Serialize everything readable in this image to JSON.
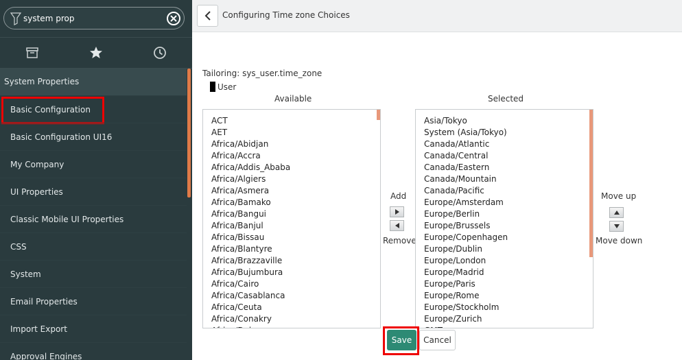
{
  "sidebar": {
    "filter_value": "system prop",
    "tabs": [
      {
        "icon": "archive-icon"
      },
      {
        "icon": "star-icon"
      },
      {
        "icon": "clock-icon"
      }
    ],
    "section": "System Properties",
    "items": [
      {
        "label": "Basic Configuration"
      },
      {
        "label": "Basic Configuration UI16"
      },
      {
        "label": "My Company"
      },
      {
        "label": "UI Properties"
      },
      {
        "label": "Classic Mobile UI Properties"
      },
      {
        "label": "CSS"
      },
      {
        "label": "System"
      },
      {
        "label": "Email Properties"
      },
      {
        "label": "Import Export"
      },
      {
        "label": "Approval Engines"
      }
    ]
  },
  "header": {
    "title": "Configuring Time zone Choices"
  },
  "tailoring": {
    "label": "Tailoring:",
    "value": "sys_user.time_zone",
    "user": "User"
  },
  "available": {
    "heading": "Available",
    "items": [
      "ACT",
      "AET",
      "Africa/Abidjan",
      "Africa/Accra",
      "Africa/Addis_Ababa",
      "Africa/Algiers",
      "Africa/Asmera",
      "Africa/Bamako",
      "Africa/Bangui",
      "Africa/Banjul",
      "Africa/Bissau",
      "Africa/Blantyre",
      "Africa/Brazzaville",
      "Africa/Bujumbura",
      "Africa/Cairo",
      "Africa/Casablanca",
      "Africa/Ceuta",
      "Africa/Conakry",
      "Africa/Dakar"
    ]
  },
  "selected": {
    "heading": "Selected",
    "items": [
      "Asia/Tokyo",
      "System (Asia/Tokyo)",
      "Canada/Atlantic",
      "Canada/Central",
      "Canada/Eastern",
      "Canada/Mountain",
      "Canada/Pacific",
      "Europe/Amsterdam",
      "Europe/Berlin",
      "Europe/Brussels",
      "Europe/Copenhagen",
      "Europe/Dublin",
      "Europe/London",
      "Europe/Madrid",
      "Europe/Paris",
      "Europe/Rome",
      "Europe/Stockholm",
      "Europe/Zurich",
      "GMT"
    ]
  },
  "controls": {
    "add": "Add",
    "remove": "Remove",
    "move_up": "Move up",
    "move_down": "Move down",
    "save": "Save",
    "cancel": "Cancel"
  },
  "colors": {
    "sidebar_bg": "#2a3b3e",
    "save_bg": "#2d8a74",
    "highlight": "#ee0000",
    "scroll_accent": "#e07a48"
  }
}
